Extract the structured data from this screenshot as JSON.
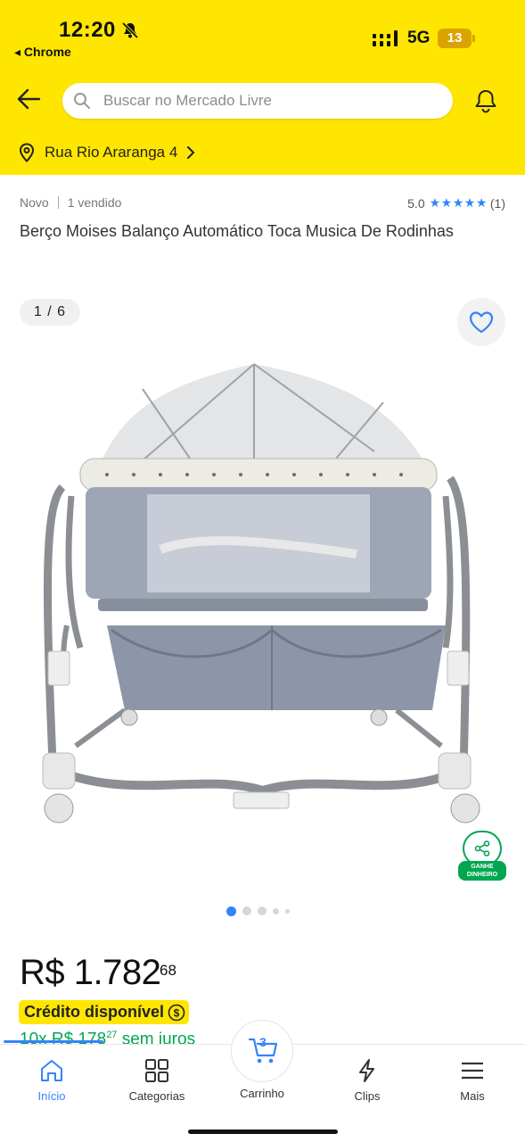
{
  "status_bar": {
    "time": "12:20",
    "back_app": "◂ Chrome",
    "network": "5G",
    "battery": "13"
  },
  "header": {
    "search_placeholder": "Buscar no Mercado Livre",
    "address": "Rua Rio Araranga 4",
    "brand_color": "#ffe600"
  },
  "product": {
    "condition": "Novo",
    "sold": "1 vendido",
    "rating": "5.0",
    "stars": "★★★★★",
    "reviews": "(1)",
    "title": "Berço Moises Balanço Automático Toca Musica De Rodinhas",
    "image_counter": "1 / 6",
    "share_label_1": "GANHE",
    "share_label_2": "DINHEIRO",
    "price_main": "R$ 1.782",
    "price_cents": "68",
    "credit_label": "Crédito disponível",
    "installments_prefix": "10x R$ 178",
    "installments_cents": "27",
    "installments_suffix": " sem juros",
    "carousel_dots": 5,
    "active_dot": 0
  },
  "bottom_nav": {
    "items": [
      {
        "label": "Início",
        "icon": "home-icon"
      },
      {
        "label": "Categorias",
        "icon": "grid-icon"
      },
      {
        "label": "Carrinho",
        "icon": "cart-icon"
      },
      {
        "label": "Clips",
        "icon": "clips-icon"
      },
      {
        "label": "Mais",
        "icon": "menu-icon"
      }
    ],
    "cart_count": "3",
    "accent_color": "#3483fa"
  }
}
